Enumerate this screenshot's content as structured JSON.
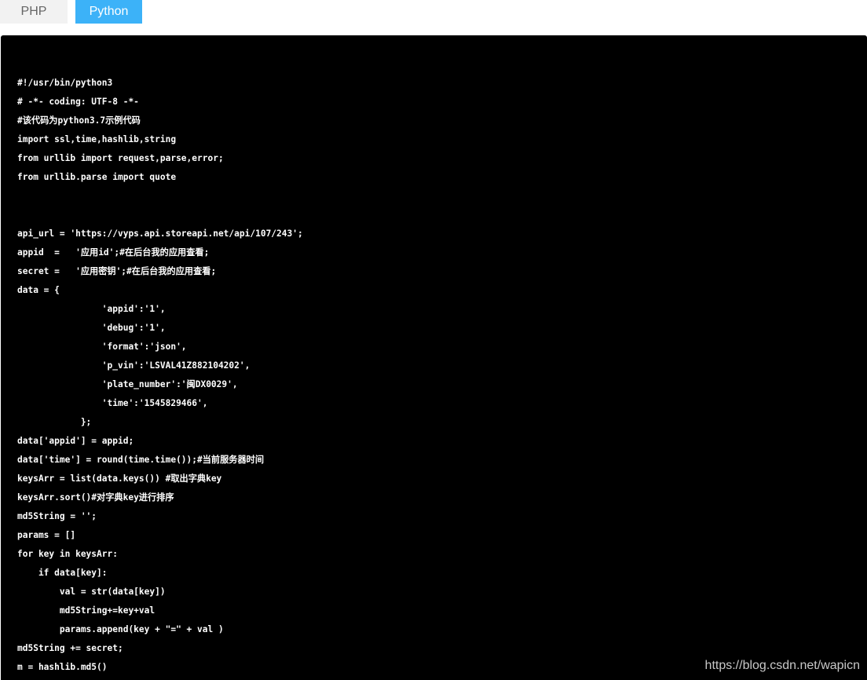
{
  "tabs": {
    "php_label": "PHP",
    "python_label": "Python",
    "active": "Python"
  },
  "colors": {
    "active_tab": "#3cb2f8",
    "inactive_tab": "#f2f2f2",
    "code_background": "#000000",
    "code_text": "#ffffff"
  },
  "code_lines": [
    "#!/usr/bin/python3",
    "# -*- coding: UTF-8 -*-",
    "#该代码为python3.7示例代码",
    "import ssl,time,hashlib,string",
    "from urllib import request,parse,error;",
    "from urllib.parse import quote",
    "",
    "",
    "api_url = 'https://vyps.api.storeapi.net/api/107/243';",
    "appid  =   '应用id';#在后台我的应用查看;",
    "secret =   '应用密钥';#在后台我的应用查看;",
    "data = {",
    "                'appid':'1',",
    "                'debug':'1',",
    "                'format':'json',",
    "                'p_vin':'LSVAL41Z882104202',",
    "                'plate_number':'闽DX0029',",
    "                'time':'1545829466',",
    "            };",
    "data['appid'] = appid;",
    "data['time'] = round(time.time());#当前服务器时间",
    "keysArr = list(data.keys()) #取出字典key",
    "keysArr.sort()#对字典key进行排序",
    "md5String = '';",
    "params = []",
    "for key in keysArr:",
    "    if data[key]:",
    "        val = str(data[key])",
    "        md5String+=key+val",
    "        params.append(key + \"=\" + val )",
    "md5String += secret;",
    "m = hashlib.md5()"
  ],
  "watermark": "https://blog.csdn.net/wapicn"
}
